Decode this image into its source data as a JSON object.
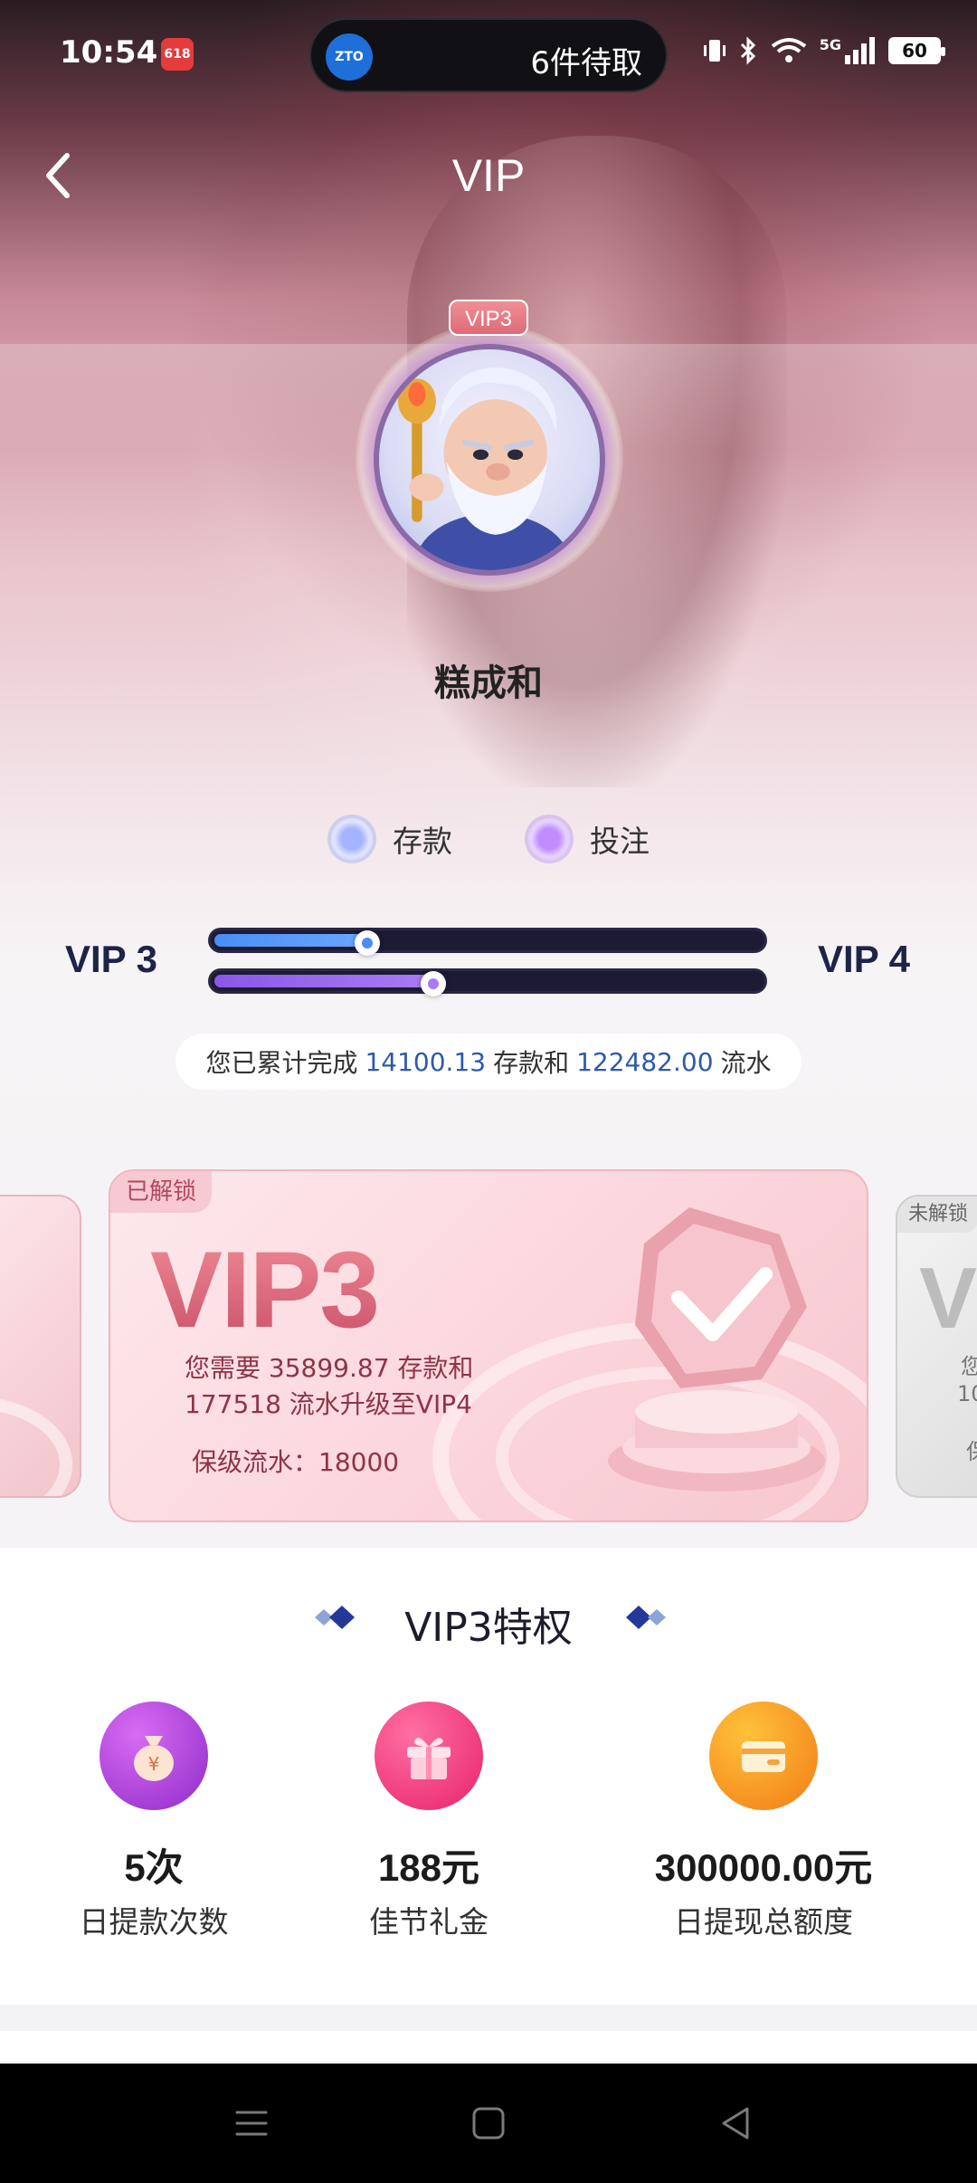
{
  "status_bar": {
    "time": "10:54",
    "app_badge": "618",
    "pill_logo": "ZTO",
    "pill_text": "6件待取",
    "network": "5G",
    "battery": "60"
  },
  "header": {
    "back_icon": "chevron-left-icon",
    "title": "VIP"
  },
  "profile": {
    "level_badge": "VIP3",
    "username": "糕成和"
  },
  "legend": {
    "deposit_label": "存款",
    "bet_label": "投注"
  },
  "progress": {
    "current_level": "VIP 3",
    "next_level": "VIP 4",
    "deposit_fraction": 0.28,
    "turnover_fraction": 0.4,
    "summary_prefix": "您已累计完成",
    "deposit_done": "14100.13",
    "summary_mid": "存款和",
    "turnover_done": "122482.00",
    "summary_suffix": "流水"
  },
  "cards": {
    "left_card": {},
    "current": {
      "tag": "已解锁",
      "level": "VIP3",
      "requirement_line1": "您需要 35899.87 存款和",
      "requirement_line2": "177518 流水升级至VIP4",
      "keep_turnover": "保级流水：18000"
    },
    "next": {
      "tag": "未解锁",
      "level_partial": "V",
      "line1": "您",
      "line2": "10",
      "line3": "保"
    }
  },
  "privileges": {
    "title": "VIP3特权",
    "items": [
      {
        "value": "5次",
        "label": "日提款次数",
        "icon": "money-bag-icon"
      },
      {
        "value": "188元",
        "label": "佳节礼金",
        "icon": "gift-icon"
      },
      {
        "value": "300000.00元",
        "label": "日提现总额度",
        "icon": "wallet-card-icon"
      }
    ]
  },
  "colors": {
    "accent_blue": "#4a8df5",
    "accent_purple": "#a97bf5",
    "highlight_number": "#2e5aa8",
    "card_pink": "#fbd6dc"
  }
}
